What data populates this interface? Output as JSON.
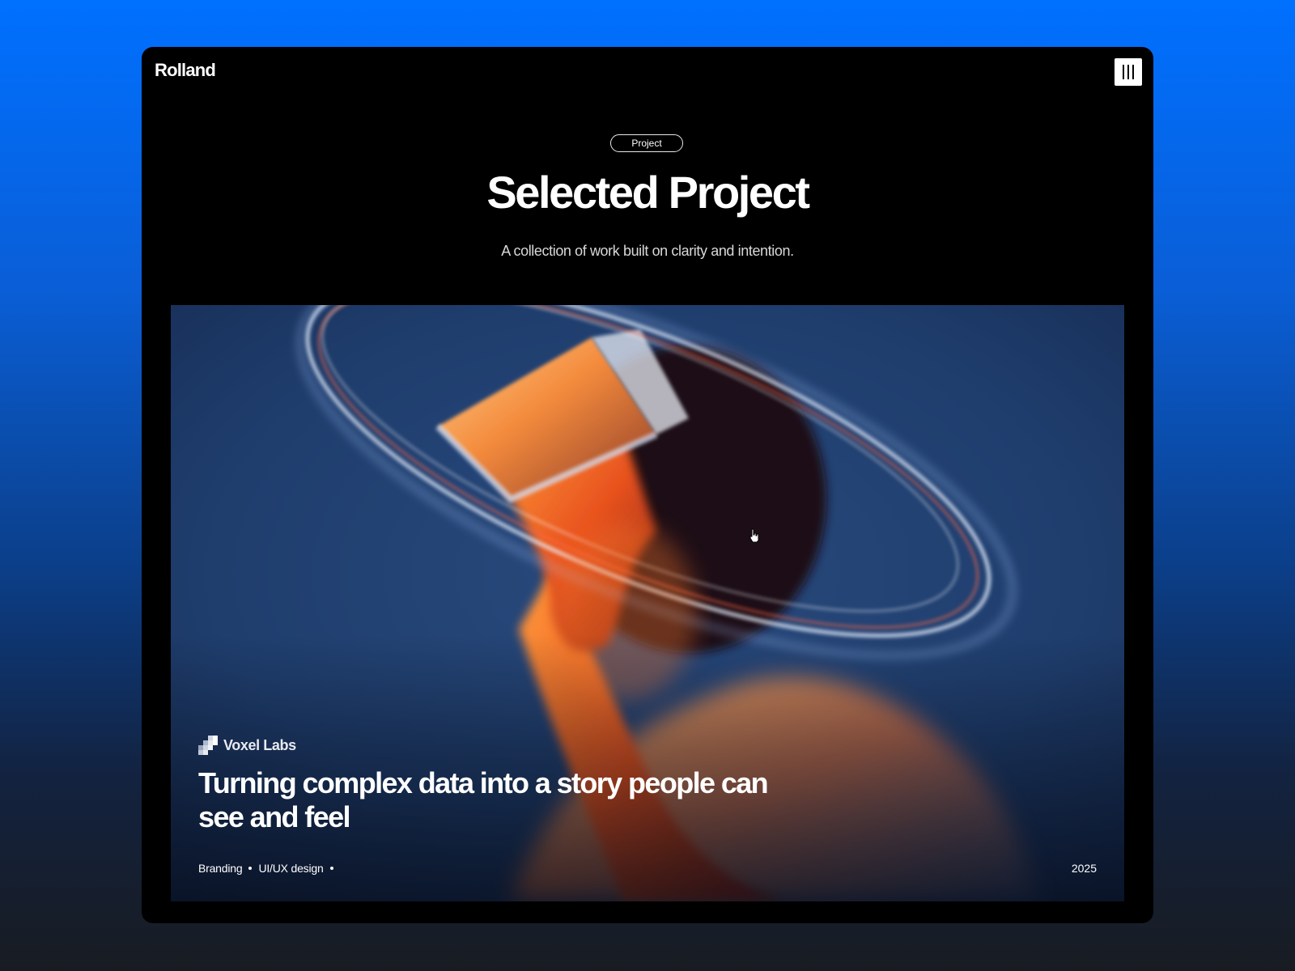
{
  "app": {
    "logo": "Rolland",
    "menu_icon": "menu-bars-icon"
  },
  "header": {
    "badge": "Project",
    "title": "Selected Project",
    "subtitle": "A collection of work built on clarity and intention."
  },
  "project": {
    "image_icon": "vr-headset-light-portrait",
    "client": "Voxel Labs",
    "client_icon": "pixel-grid-icon",
    "headline": "Turning complex data into a story people can see and feel",
    "tags": [
      "Branding",
      "UI/UX design"
    ],
    "year": "2025"
  },
  "colors": {
    "accent_blue": "#0070ff",
    "frame_bg": "#000000",
    "text": "#ffffff"
  }
}
